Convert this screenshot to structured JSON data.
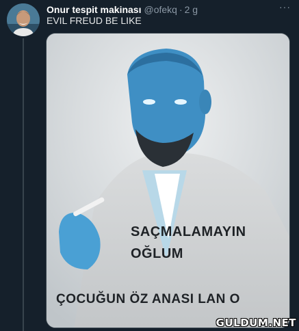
{
  "tweet": {
    "author_name": "Onur tespit makinası",
    "handle": "@ofekq",
    "separator": "·",
    "time": "2 g",
    "more_label": "···",
    "text": "EVIL FREUD BE LIKE"
  },
  "media": {
    "caption_line1": "SAÇMALAMAYIN",
    "caption_line2": "OĞLUM",
    "caption_line3": "ÇOCUĞUN ÖZ ANASI LAN O",
    "watermark": "GULDUM.NET"
  }
}
